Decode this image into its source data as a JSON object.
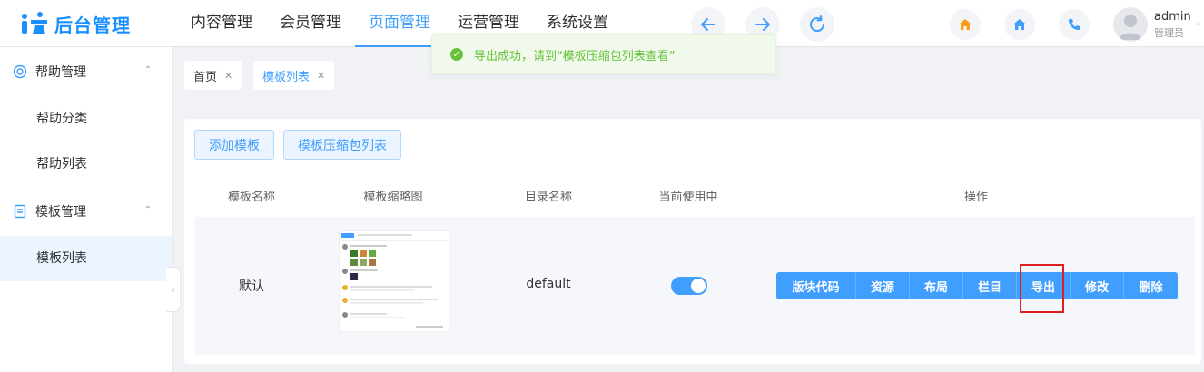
{
  "brand": {
    "logo_text": "后台管理",
    "accent": "#409eff"
  },
  "nav": {
    "items": [
      "内容管理",
      "会员管理",
      "页面管理",
      "运营管理",
      "系统设置"
    ],
    "active_index": 2
  },
  "toolbar_icons": [
    "arrow-left-icon",
    "arrow-right-icon",
    "refresh-icon"
  ],
  "quick_icons": [
    "home-orange-icon",
    "home-blue-icon",
    "phone-icon"
  ],
  "user": {
    "name": "admin",
    "role": "管理员"
  },
  "toast": {
    "text": "导出成功，请到“模板压缩包列表查看”",
    "type": "success",
    "color": "#67c23a"
  },
  "sidebar": {
    "groups": [
      {
        "label": "帮助管理",
        "icon": "lifebuoy-icon",
        "items": [
          "帮助分类",
          "帮助列表"
        ]
      },
      {
        "label": "模板管理",
        "icon": "document-icon",
        "items": [
          "模板列表"
        ]
      }
    ],
    "active_item": "模板列表"
  },
  "tags": [
    "首页",
    "模板列表"
  ],
  "buttons": {
    "add_template": "添加模板",
    "zip_list": "模板压缩包列表"
  },
  "table": {
    "headers": [
      "模板名称",
      "模板缩略图",
      "目录名称",
      "当前使用中",
      "操作"
    ],
    "rows": [
      {
        "name": "默认",
        "dir": "default",
        "in_use": true
      }
    ],
    "row_actions": [
      "版块代码",
      "资源",
      "布局",
      "栏目",
      "导出",
      "修改",
      "删除"
    ],
    "highlighted_action": "导出"
  }
}
